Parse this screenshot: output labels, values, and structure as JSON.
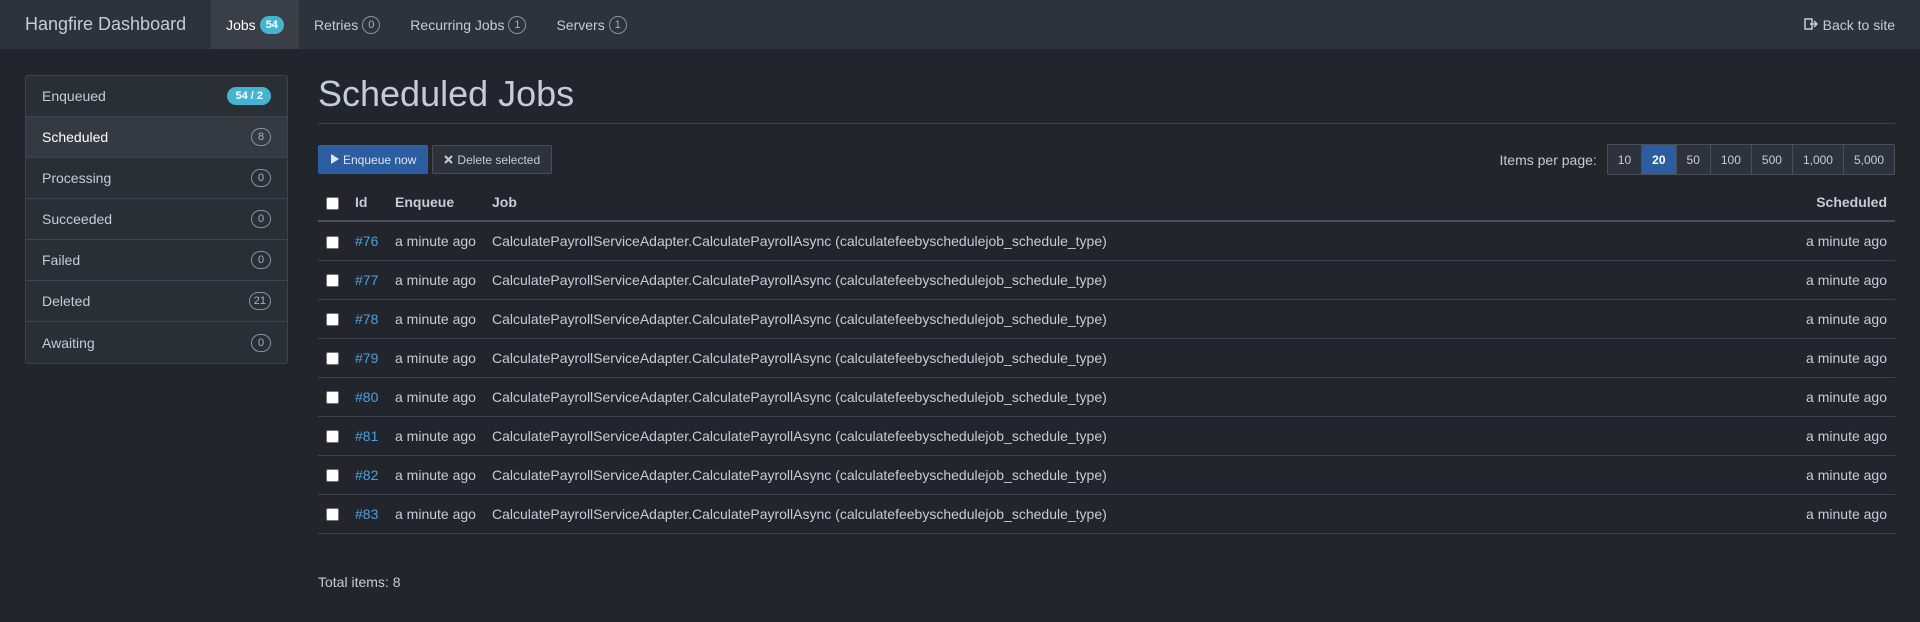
{
  "navbar": {
    "brand": "Hangfire Dashboard",
    "items": [
      {
        "label": "Jobs",
        "count": "54",
        "active": true
      },
      {
        "label": "Retries",
        "count": "0"
      },
      {
        "label": "Recurring Jobs",
        "count": "1"
      },
      {
        "label": "Servers",
        "count": "1"
      }
    ],
    "back_label": "Back to site"
  },
  "sidebar": {
    "items": [
      {
        "label": "Enqueued",
        "count": "54 / 2"
      },
      {
        "label": "Scheduled",
        "count": "8"
      },
      {
        "label": "Processing",
        "count": "0"
      },
      {
        "label": "Succeeded",
        "count": "0"
      },
      {
        "label": "Failed",
        "count": "0"
      },
      {
        "label": "Deleted",
        "count": "21"
      },
      {
        "label": "Awaiting",
        "count": "0"
      }
    ]
  },
  "main": {
    "title": "Scheduled Jobs",
    "enqueue_label": "Enqueue now",
    "delete_label": "Delete selected",
    "items_per_page_label": "Items per page:",
    "page_sizes": [
      "10",
      "20",
      "50",
      "100",
      "500",
      "1,000",
      "5,000"
    ],
    "selected_page_size": "20",
    "columns": {
      "id": "Id",
      "enqueue": "Enqueue",
      "job": "Job",
      "scheduled": "Scheduled"
    },
    "rows": [
      {
        "id": "#76",
        "enqueue": "a minute ago",
        "job": "CalculatePayrollServiceAdapter.CalculatePayrollAsync (calculatefeebyschedulejob_schedule_type)",
        "scheduled": "a minute ago"
      },
      {
        "id": "#77",
        "enqueue": "a minute ago",
        "job": "CalculatePayrollServiceAdapter.CalculatePayrollAsync (calculatefeebyschedulejob_schedule_type)",
        "scheduled": "a minute ago"
      },
      {
        "id": "#78",
        "enqueue": "a minute ago",
        "job": "CalculatePayrollServiceAdapter.CalculatePayrollAsync (calculatefeebyschedulejob_schedule_type)",
        "scheduled": "a minute ago"
      },
      {
        "id": "#79",
        "enqueue": "a minute ago",
        "job": "CalculatePayrollServiceAdapter.CalculatePayrollAsync (calculatefeebyschedulejob_schedule_type)",
        "scheduled": "a minute ago"
      },
      {
        "id": "#80",
        "enqueue": "a minute ago",
        "job": "CalculatePayrollServiceAdapter.CalculatePayrollAsync (calculatefeebyschedulejob_schedule_type)",
        "scheduled": "a minute ago"
      },
      {
        "id": "#81",
        "enqueue": "a minute ago",
        "job": "CalculatePayrollServiceAdapter.CalculatePayrollAsync (calculatefeebyschedulejob_schedule_type)",
        "scheduled": "a minute ago"
      },
      {
        "id": "#82",
        "enqueue": "a minute ago",
        "job": "CalculatePayrollServiceAdapter.CalculatePayrollAsync (calculatefeebyschedulejob_schedule_type)",
        "scheduled": "a minute ago"
      },
      {
        "id": "#83",
        "enqueue": "a minute ago",
        "job": "CalculatePayrollServiceAdapter.CalculatePayrollAsync (calculatefeebyschedulejob_schedule_type)",
        "scheduled": "a minute ago"
      }
    ],
    "total_label": "Total items: 8"
  }
}
